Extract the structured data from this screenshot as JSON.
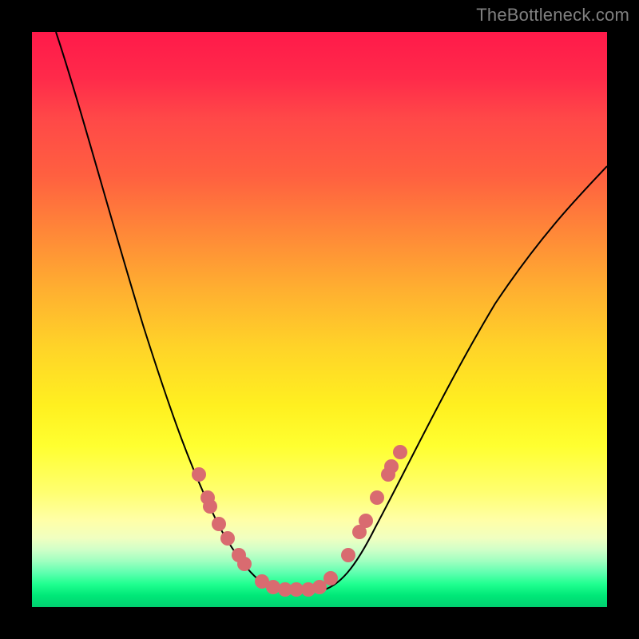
{
  "watermark": "TheBottleneck.com",
  "chart_data": {
    "type": "line",
    "title": "",
    "xlabel": "",
    "ylabel": "",
    "xlim": [
      0,
      100
    ],
    "ylim": [
      0,
      100
    ],
    "series": [
      {
        "name": "bottleneck-curve-left",
        "x": [
          4,
          6,
          8,
          10,
          12,
          14,
          16,
          18,
          20,
          22,
          24,
          26,
          28,
          30,
          32,
          34,
          36,
          38,
          40,
          42
        ],
        "y": [
          100,
          94,
          88,
          82,
          76,
          70,
          64,
          57,
          50,
          43,
          37,
          31,
          26,
          21,
          17,
          13,
          10,
          7,
          5,
          3
        ]
      },
      {
        "name": "bottleneck-curve-right",
        "x": [
          50,
          52,
          54,
          56,
          58,
          60,
          62,
          64,
          66,
          70,
          74,
          78,
          82,
          86,
          90,
          94,
          98,
          100
        ],
        "y": [
          3,
          5,
          8,
          11,
          15,
          19,
          23,
          27,
          31,
          38,
          45,
          51,
          56,
          61,
          65,
          69,
          72,
          74
        ]
      }
    ],
    "flat_bottom": {
      "x_start": 42,
      "x_end": 50,
      "y": 3
    },
    "markers": [
      {
        "x": 29,
        "y": 23
      },
      {
        "x": 30.5,
        "y": 19
      },
      {
        "x": 31,
        "y": 17.5
      },
      {
        "x": 32.5,
        "y": 14.5
      },
      {
        "x": 34,
        "y": 12
      },
      {
        "x": 36,
        "y": 9
      },
      {
        "x": 37,
        "y": 7.5
      },
      {
        "x": 40,
        "y": 4.5
      },
      {
        "x": 42,
        "y": 3.5
      },
      {
        "x": 44,
        "y": 3
      },
      {
        "x": 46,
        "y": 3
      },
      {
        "x": 48,
        "y": 3
      },
      {
        "x": 50,
        "y": 3.5
      },
      {
        "x": 52,
        "y": 5
      },
      {
        "x": 55,
        "y": 9
      },
      {
        "x": 57,
        "y": 13
      },
      {
        "x": 58,
        "y": 15
      },
      {
        "x": 60,
        "y": 19
      },
      {
        "x": 62,
        "y": 23
      },
      {
        "x": 62.5,
        "y": 24.5
      },
      {
        "x": 64,
        "y": 27
      }
    ],
    "background_gradient": {
      "top_color": "#ff1a4a",
      "mid_color": "#ffff30",
      "bottom_color": "#00d070"
    }
  }
}
